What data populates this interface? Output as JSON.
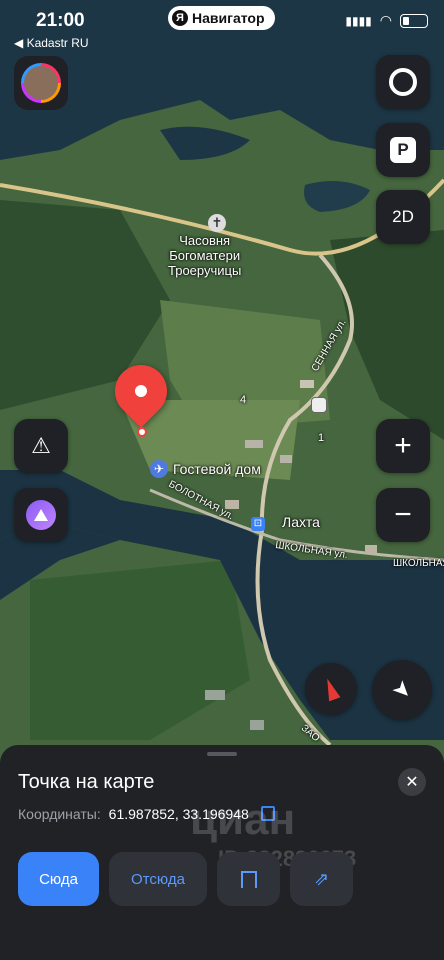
{
  "status_bar": {
    "time": "21:00",
    "back_label": "◀ Kadastr RU"
  },
  "app_pill": {
    "logo": "Я",
    "label": "Навигатор"
  },
  "map": {
    "labels": {
      "chapel": "Часовня\nБогоматери\nТроеручицы",
      "guest_house": "Гостевой дом",
      "lakhta": "Лахта",
      "sennaya": "СЕННАЯ ул.",
      "bolotnaya": "БОЛОТНАЯ ул.",
      "shkolnaya": "ШКОЛЬНАЯ ул.",
      "shkolnaya2": "ШКОЛЬНАЯ",
      "zao": "ЗАО",
      "house_4": "4",
      "house_1": "1"
    }
  },
  "controls": {
    "layers_icon": "circle-icon",
    "parking_label": "P",
    "view_mode_label": "2D",
    "zoom_in_label": "+",
    "zoom_out_label": "−"
  },
  "sheet": {
    "title": "Точка на карте",
    "coords_label": "Координаты:",
    "coords_value": "61.987852, 33.196948",
    "watermark": "циан",
    "watermark_id": "ID 322896673",
    "btn_here": "Сюда",
    "btn_from": "Отсюда"
  },
  "colors": {
    "accent": "#3a82f7",
    "pin": "#f0413c",
    "panel": "#202226"
  }
}
